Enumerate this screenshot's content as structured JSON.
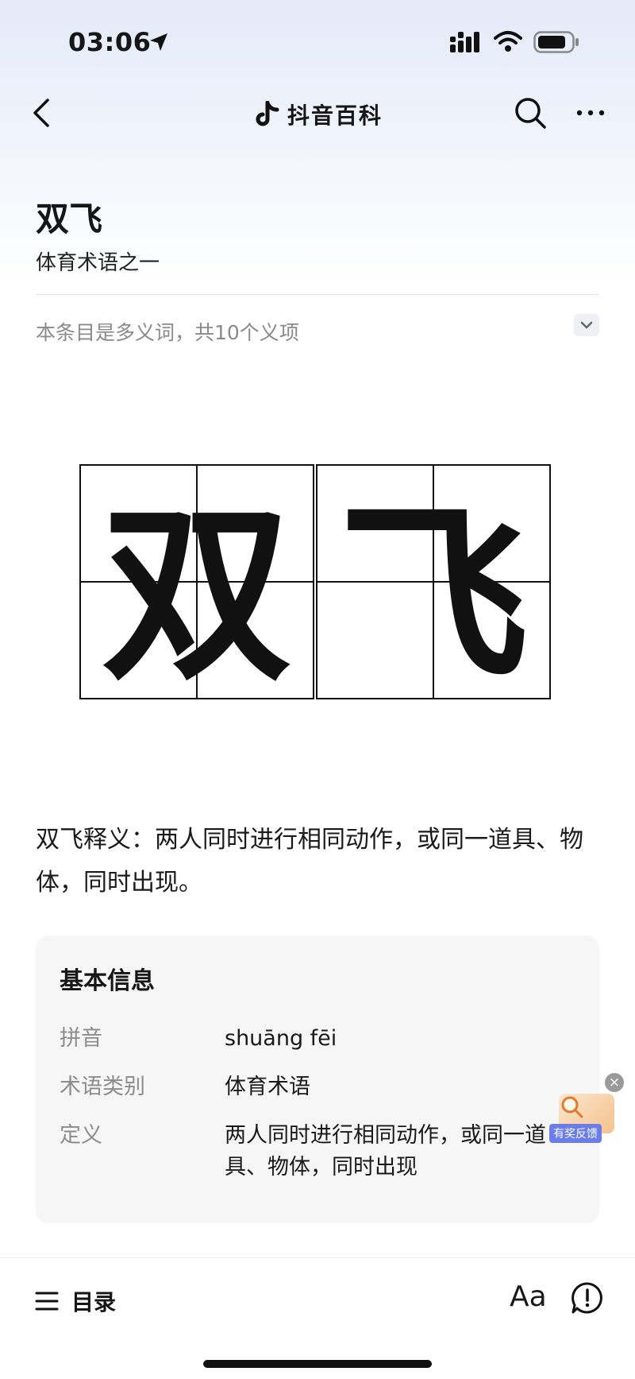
{
  "status_bar": {
    "time": "03:06"
  },
  "navbar": {
    "title": "抖音百科"
  },
  "entry": {
    "title": "双飞",
    "subtitle": "体育术语之一",
    "polysemy_note": "本条目是多义词，共10个义项",
    "image_chars": [
      "双",
      "飞"
    ],
    "definition": "双飞释义：两人同时进行相同动作，或同一道具、物体，同时出现。"
  },
  "info_card": {
    "title": "基本信息",
    "rows": [
      {
        "label": "拼音",
        "value": "shuāng fēi"
      },
      {
        "label": "术语类别",
        "value": "体育术语"
      },
      {
        "label": "定义",
        "value": "两人同时进行相同动作，或同一道具、物体，同时出现"
      }
    ]
  },
  "feedback": {
    "label": "有奖反馈",
    "close": "×"
  },
  "bottom_bar": {
    "toc_label": "目录",
    "font_label": "Aa"
  },
  "icons": {
    "location": "location-arrow-icon",
    "signal": "cellular-signal-icon",
    "wifi": "wifi-icon",
    "battery": "battery-icon",
    "back": "chevron-left-icon",
    "logo": "douyin-logo-icon",
    "search": "search-icon",
    "more": "more-dots-icon",
    "expand": "chevron-down-icon",
    "menu": "menu-lines-icon",
    "report": "exclamation-bubble-icon"
  }
}
